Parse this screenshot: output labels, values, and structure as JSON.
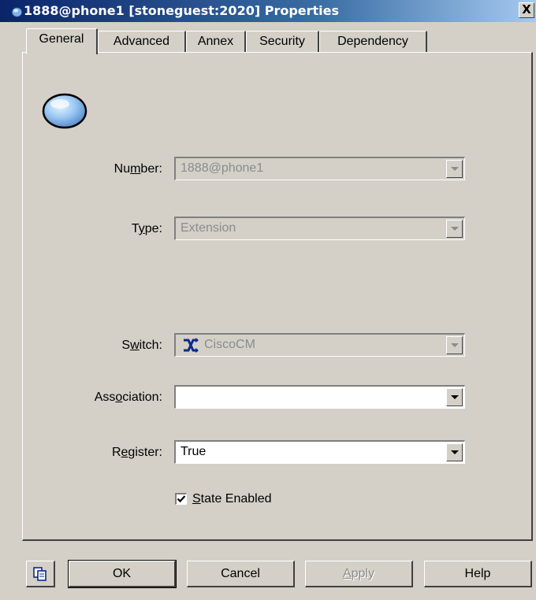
{
  "window": {
    "title": "1888@phone1 [stoneguest:2020] Properties",
    "close_label": "X"
  },
  "tabs": [
    {
      "label": "General",
      "active": true
    },
    {
      "label": "Advanced",
      "active": false
    },
    {
      "label": "Annex",
      "active": false
    },
    {
      "label": "Security",
      "active": false
    },
    {
      "label": "Dependency",
      "active": false
    }
  ],
  "form": {
    "number": {
      "label_pre": "Nu",
      "label_u": "m",
      "label_post": "ber:",
      "value": "1888@phone1",
      "enabled": false
    },
    "type": {
      "label_pre": "T",
      "label_u": "y",
      "label_post": "pe:",
      "value": "Extension",
      "enabled": false
    },
    "switch": {
      "label_pre": "S",
      "label_u": "w",
      "label_post": "itch:",
      "value": "CiscoCM",
      "enabled": false,
      "icon": "cisco-switch-icon"
    },
    "association": {
      "label_pre": "Ass",
      "label_u": "o",
      "label_post": "ciation:",
      "value": "",
      "enabled": true
    },
    "register": {
      "label_pre": "R",
      "label_u": "e",
      "label_post": "gister:",
      "value": "True",
      "enabled": true
    },
    "state_enabled": {
      "label_u": "S",
      "label_post": "tate Enabled",
      "checked": true
    }
  },
  "buttons": {
    "ok": "OK",
    "cancel": "Cancel",
    "apply_u": "A",
    "apply_post": "pply",
    "help": "Help"
  },
  "colors": {
    "dialog_bg": "#d4d0c8",
    "title_start": "#0a246a",
    "title_end": "#a6caf0",
    "disabled_text": "#8c8c8c"
  }
}
